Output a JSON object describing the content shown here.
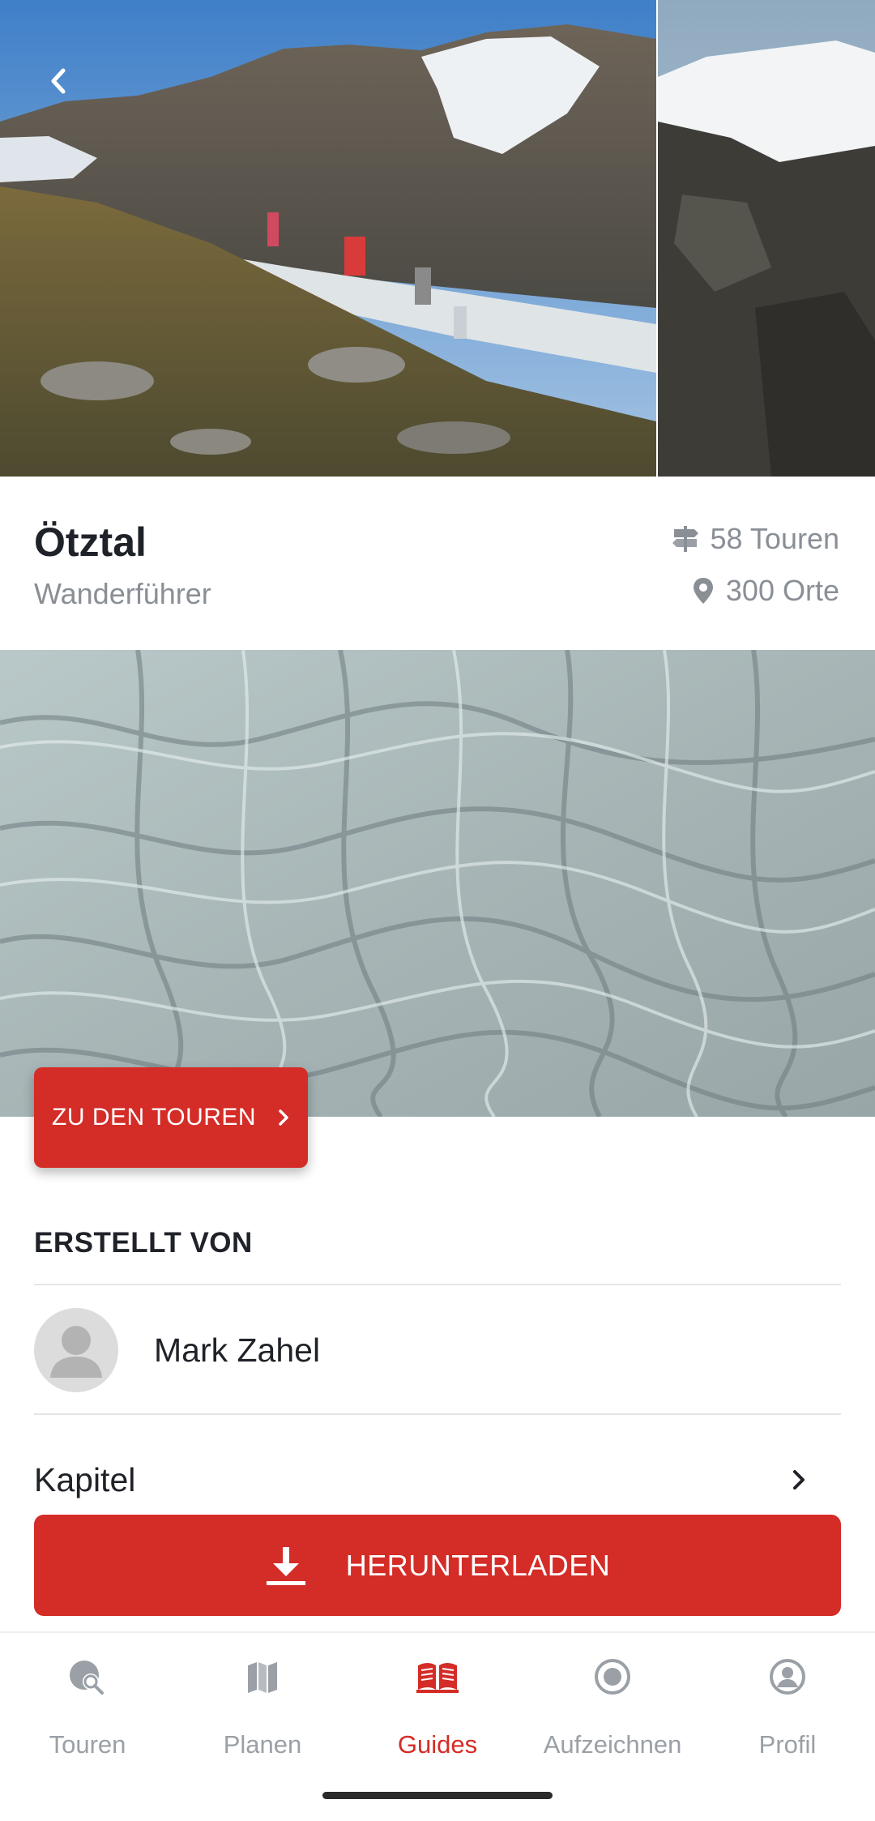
{
  "header": {
    "title": "Ötztal",
    "subtitle": "Wanderführer",
    "tours_count": "58 Touren",
    "places_count": "300 Orte"
  },
  "cta": {
    "label": "ZU DEN TOUREN"
  },
  "author": {
    "section_title": "ERSTELLT VON",
    "name": "Mark Zahel"
  },
  "chapters": {
    "label": "Kapitel"
  },
  "download": {
    "label": "HERUNTERLADEN"
  },
  "bottom_nav": {
    "active": "Guides",
    "items": [
      {
        "label": "Touren",
        "icon": "tour-search-icon"
      },
      {
        "label": "Planen",
        "icon": "map-icon"
      },
      {
        "label": "Guides",
        "icon": "book-icon"
      },
      {
        "label": "Aufzeichnen",
        "icon": "record-icon"
      },
      {
        "label": "Profil",
        "icon": "profile-icon"
      }
    ]
  },
  "colors": {
    "accent": "#d42c27",
    "text_primary": "#1f2228",
    "text_secondary": "#8a8f96",
    "nav_inactive": "#9aa0a6"
  }
}
